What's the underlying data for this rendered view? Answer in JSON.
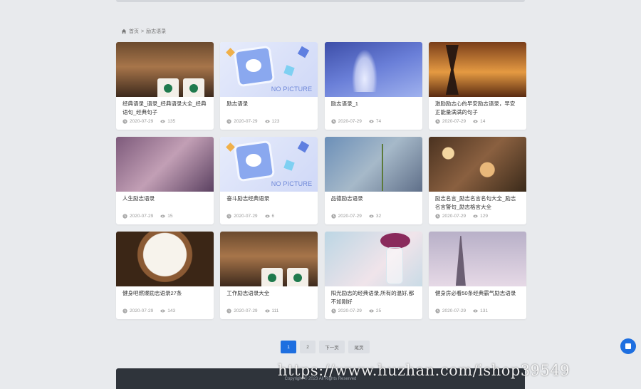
{
  "breadcrumb": {
    "home": "首页",
    "separator": ">",
    "current": "励志语录"
  },
  "cards": [
    {
      "title": "经典语录_语录_经典语录大全_经典语句_经典句子",
      "date": "2020-07-29",
      "views": "135",
      "thumb": "t-coffee"
    },
    {
      "title": "励志语录",
      "date": "2020-07-29",
      "views": "123",
      "thumb": "t-nopic"
    },
    {
      "title": "励志语录_1",
      "date": "2020-07-29",
      "views": "74",
      "thumb": "t-ballet"
    },
    {
      "title": "激励励志心的早安励志语录，早安正能量满满的句子",
      "date": "2020-07-29",
      "views": "14",
      "thumb": "t-hourglass"
    },
    {
      "title": "人生励志语录",
      "date": "2020-07-29",
      "views": "15",
      "thumb": "t-rain"
    },
    {
      "title": "奋斗励志经典语录",
      "date": "2020-07-29",
      "views": "6",
      "thumb": "t-nopic"
    },
    {
      "title": "品德励志语录",
      "date": "2020-07-29",
      "views": "32",
      "thumb": "t-flower"
    },
    {
      "title": "励志名言_励志名言名句大全_励志名言警句_励志格言大全",
      "date": "2020-07-29",
      "views": "129",
      "thumb": "t-bokeh"
    },
    {
      "title": "健身吧燃爆励志语录27条",
      "date": "2020-07-29",
      "views": "143",
      "thumb": "t-latte"
    },
    {
      "title": "工作励志语录大全",
      "date": "2020-07-29",
      "views": "111",
      "thumb": "t-coffee"
    },
    {
      "title": "阳光励志的经典语录,所有的温好,都不如刚好",
      "date": "2020-07-29",
      "views": "25",
      "thumb": "t-vase"
    },
    {
      "title": "健身房必看50条经典霸气励志语录",
      "date": "2020-07-29",
      "views": "131",
      "thumb": "t-tower"
    }
  ],
  "nopic_label": "NO PICTURE",
  "pagination": {
    "current": "1",
    "next_num": "2",
    "next_label": "下一页",
    "last_label": "尾页"
  },
  "footer": {
    "text": "Copyright © 2023 All Rights Reserved"
  },
  "watermark": "https://www.huzhan.com/ishop39549",
  "colors": {
    "accent": "#1e6fe0",
    "footer_bg": "#2f343b",
    "page_bg": "#e8eaed"
  },
  "icons": {
    "home": "home-icon",
    "clock": "clock-icon",
    "views": "eye-icon",
    "float": "message-icon"
  }
}
